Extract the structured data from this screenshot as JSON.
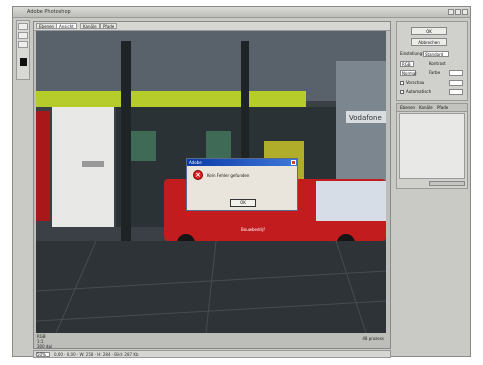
{
  "app": {
    "title": "Adobe Photoshop"
  },
  "document": {
    "tabs": [
      {
        "label": "Ebenen"
      },
      {
        "label": "Ansicht"
      },
      {
        "label": "Kanäle"
      },
      {
        "label": "Pfade"
      }
    ],
    "status_info": [
      "RGB",
      "1:1",
      "300 dpi",
      "47%"
    ],
    "status_right": "48 prozess",
    "bottom_field": "50%",
    "bottom_text": "0,00 · 0,00 · W: 258 · H: 284 · Bild: 287 Kb"
  },
  "options_panel": {
    "ok_label": "OK",
    "cancel_label": "Abbrechen",
    "preset_label": "Einstellung:",
    "preset_value": "Standard",
    "mode_value": "RGB",
    "row1_label": "Kontrast",
    "row2_label": "Vorschau",
    "row3_label": "Normal",
    "row4_label": "Farbe",
    "check1": "Vorschau",
    "check2": "Automatisch"
  },
  "layers_panel": {
    "tabs": [
      {
        "label": "Ebenen"
      },
      {
        "label": "Kanäle"
      },
      {
        "label": "Pfade"
      }
    ]
  },
  "dialog": {
    "title": "Adobe",
    "message": "Kein Fehler gefunden",
    "ok_label": "OK"
  },
  "photo": {
    "shop_sign": "Vodafone",
    "van_text": "Bouwbedrijf"
  },
  "colors": {
    "lime_band": "#b5cc2a",
    "van_red": "#c21c1e",
    "dialog_title": "#0a3aa8"
  }
}
